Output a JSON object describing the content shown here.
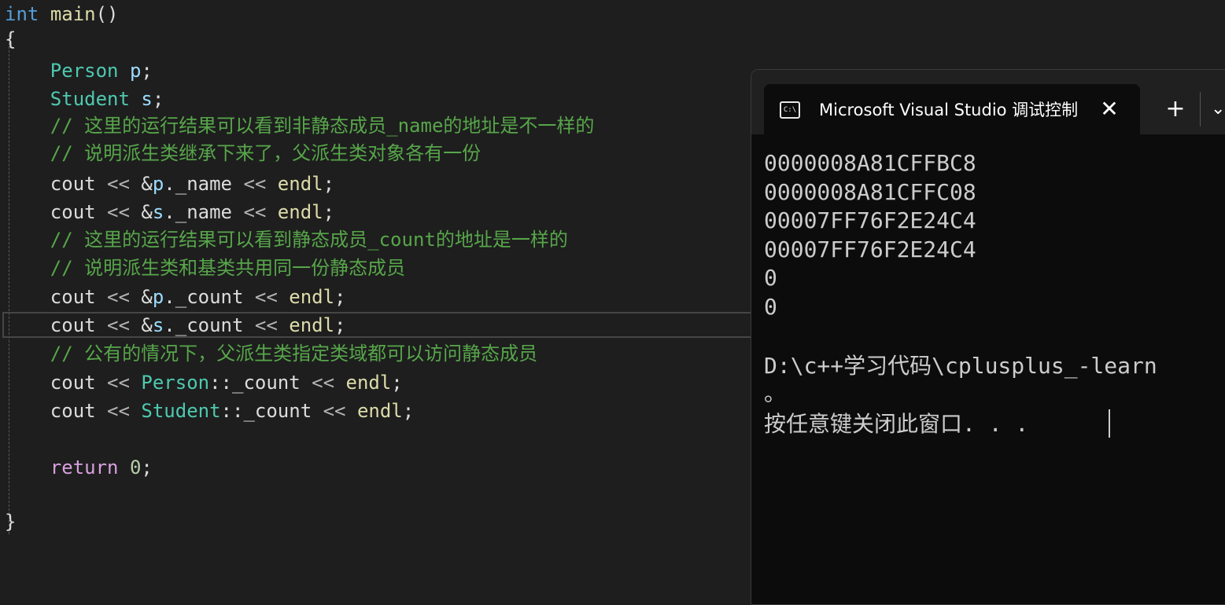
{
  "editor": {
    "lines": [
      {
        "tokens": [
          {
            "c": "kw",
            "t": "int"
          },
          {
            "c": "pl",
            "t": " "
          },
          {
            "c": "fn",
            "t": "main"
          },
          {
            "c": "pl",
            "t": "()"
          }
        ]
      },
      {
        "tokens": [
          {
            "c": "pl",
            "t": "{"
          }
        ]
      },
      {
        "tokens": [
          {
            "c": "pl",
            "t": "    "
          },
          {
            "c": "ty",
            "t": "Person"
          },
          {
            "c": "pl",
            "t": " "
          },
          {
            "c": "id",
            "t": "p"
          },
          {
            "c": "pl",
            "t": ";"
          }
        ]
      },
      {
        "tokens": [
          {
            "c": "pl",
            "t": "    "
          },
          {
            "c": "ty",
            "t": "Student"
          },
          {
            "c": "pl",
            "t": " "
          },
          {
            "c": "id",
            "t": "s"
          },
          {
            "c": "pl",
            "t": ";"
          }
        ]
      },
      {
        "tokens": [
          {
            "c": "pl",
            "t": "    "
          },
          {
            "c": "cm",
            "t": "// 这里的运行结果可以看到非静态成员_name的地址是不一样的"
          }
        ]
      },
      {
        "tokens": [
          {
            "c": "pl",
            "t": "    "
          },
          {
            "c": "cm",
            "t": "// 说明派生类继承下来了，父派生类对象各有一份"
          }
        ]
      },
      {
        "tokens": [
          {
            "c": "pl",
            "t": "    "
          },
          {
            "c": "pl",
            "t": "cout"
          },
          {
            "c": "op",
            "t": " << "
          },
          {
            "c": "pl",
            "t": "&"
          },
          {
            "c": "id",
            "t": "p"
          },
          {
            "c": "pl",
            "t": "."
          },
          {
            "c": "pl",
            "t": "_name"
          },
          {
            "c": "op",
            "t": " << "
          },
          {
            "c": "fn",
            "t": "endl"
          },
          {
            "c": "pl",
            "t": ";"
          }
        ]
      },
      {
        "tokens": [
          {
            "c": "pl",
            "t": "    "
          },
          {
            "c": "pl",
            "t": "cout"
          },
          {
            "c": "op",
            "t": " << "
          },
          {
            "c": "pl",
            "t": "&"
          },
          {
            "c": "id",
            "t": "s"
          },
          {
            "c": "pl",
            "t": "."
          },
          {
            "c": "pl",
            "t": "_name"
          },
          {
            "c": "op",
            "t": " << "
          },
          {
            "c": "fn",
            "t": "endl"
          },
          {
            "c": "pl",
            "t": ";"
          }
        ]
      },
      {
        "tokens": [
          {
            "c": "pl",
            "t": "    "
          },
          {
            "c": "cm",
            "t": "// 这里的运行结果可以看到静态成员_count的地址是一样的"
          }
        ]
      },
      {
        "tokens": [
          {
            "c": "pl",
            "t": "    "
          },
          {
            "c": "cm",
            "t": "// 说明派生类和基类共用同一份静态成员"
          }
        ]
      },
      {
        "tokens": [
          {
            "c": "pl",
            "t": "    "
          },
          {
            "c": "pl",
            "t": "cout"
          },
          {
            "c": "op",
            "t": " << "
          },
          {
            "c": "pl",
            "t": "&"
          },
          {
            "c": "id",
            "t": "p"
          },
          {
            "c": "pl",
            "t": "."
          },
          {
            "c": "pl",
            "t": "_count"
          },
          {
            "c": "op",
            "t": " << "
          },
          {
            "c": "fn",
            "t": "endl"
          },
          {
            "c": "pl",
            "t": ";"
          }
        ]
      },
      {
        "tokens": [
          {
            "c": "pl",
            "t": "    "
          },
          {
            "c": "pl",
            "t": "cout"
          },
          {
            "c": "op",
            "t": " << "
          },
          {
            "c": "pl",
            "t": "&"
          },
          {
            "c": "id",
            "t": "s"
          },
          {
            "c": "pl",
            "t": "."
          },
          {
            "c": "pl",
            "t": "_count"
          },
          {
            "c": "op",
            "t": " << "
          },
          {
            "c": "fn",
            "t": "endl"
          },
          {
            "c": "pl",
            "t": ";"
          }
        ]
      },
      {
        "tokens": [
          {
            "c": "pl",
            "t": "    "
          },
          {
            "c": "cm",
            "t": "// 公有的情况下，父派生类指定类域都可以访问静态成员"
          }
        ]
      },
      {
        "tokens": [
          {
            "c": "pl",
            "t": "    "
          },
          {
            "c": "pl",
            "t": "cout"
          },
          {
            "c": "op",
            "t": " << "
          },
          {
            "c": "ty",
            "t": "Person"
          },
          {
            "c": "pl",
            "t": "::"
          },
          {
            "c": "pl",
            "t": "_count"
          },
          {
            "c": "op",
            "t": " << "
          },
          {
            "c": "fn",
            "t": "endl"
          },
          {
            "c": "pl",
            "t": ";"
          }
        ]
      },
      {
        "tokens": [
          {
            "c": "pl",
            "t": "    "
          },
          {
            "c": "pl",
            "t": "cout"
          },
          {
            "c": "op",
            "t": " << "
          },
          {
            "c": "ty",
            "t": "Student"
          },
          {
            "c": "pl",
            "t": "::"
          },
          {
            "c": "pl",
            "t": "_count"
          },
          {
            "c": "op",
            "t": " << "
          },
          {
            "c": "fn",
            "t": "endl"
          },
          {
            "c": "pl",
            "t": ";"
          }
        ]
      },
      {
        "tokens": [
          {
            "c": "pl",
            "t": "    "
          },
          {
            "c": "ret",
            "t": "return"
          },
          {
            "c": "pl",
            "t": " "
          },
          {
            "c": "num",
            "t": "0"
          },
          {
            "c": "pl",
            "t": ";"
          }
        ]
      },
      {
        "tokens": [
          {
            "c": "pl",
            "t": "}"
          }
        ]
      }
    ]
  },
  "console": {
    "title": "Microsoft Visual Studio 调试控制台",
    "terminal_icon_text": "C:\\",
    "close_symbol": "✕",
    "new_tab_symbol": "+",
    "dropdown_symbol": "⌄",
    "terminal_icon": "terminal-icon",
    "output": [
      "0000008A81CFFBC8",
      "0000008A81CFFC08",
      "00007FF76F2E24C4",
      "00007FF76F2E24C4",
      "0",
      "0",
      "",
      "D:\\c++学习代码\\cplusplus_-learn",
      "。",
      "按任意键关闭此窗口. . ."
    ]
  }
}
